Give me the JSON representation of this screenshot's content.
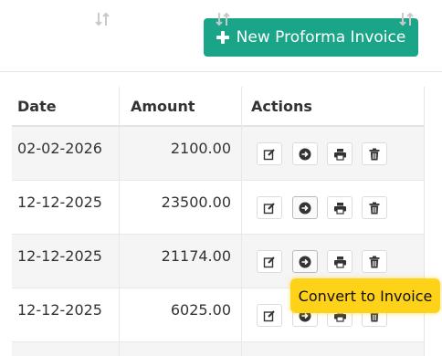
{
  "toolbar": {
    "new_button_label": "New Proforma Invoice"
  },
  "table": {
    "headers": {
      "date": "Date",
      "amount": "Amount",
      "actions": "Actions"
    },
    "rows": [
      {
        "date": "02-02-2026",
        "amount": "2100.00"
      },
      {
        "date": "12-12-2025",
        "amount": "23500.00"
      },
      {
        "date": "12-12-2025",
        "amount": "21174.00"
      },
      {
        "date": "12-12-2025",
        "amount": "6025.00"
      }
    ]
  },
  "tooltip": {
    "text": "Convert to Invoice"
  },
  "icons": {
    "accent": "#1aa589",
    "tooltip_bg": "#ffd21a"
  }
}
